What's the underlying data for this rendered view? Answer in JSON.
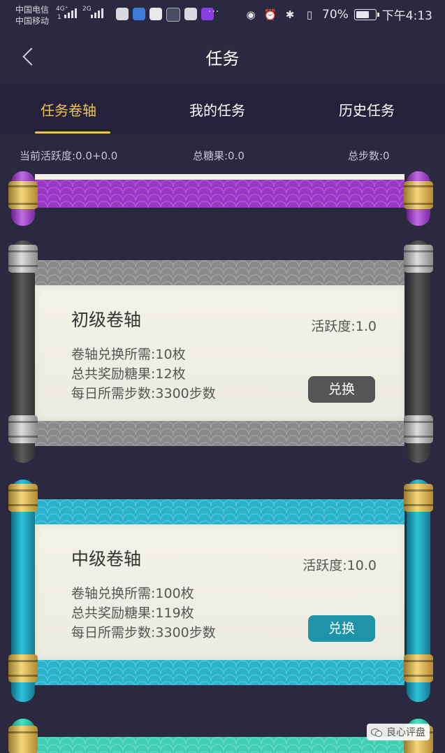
{
  "status_bar": {
    "carrier1": "中国电信",
    "carrier2": "中国移动",
    "net1": "4G⁺",
    "net1_sub": "1",
    "net2": "2G",
    "more": "···",
    "battery": "70%",
    "time": "下午4:13",
    "icons": [
      "eye-icon",
      "alarm-icon",
      "bluetooth-icon",
      "vibrate-icon",
      "battery-icon"
    ]
  },
  "header": {
    "title": "任务"
  },
  "tabs": [
    {
      "label": "任务卷轴",
      "active": true
    },
    {
      "label": "我的任务",
      "active": false
    },
    {
      "label": "历史任务",
      "active": false
    }
  ],
  "stats": {
    "activity": "当前活跃度:0.0+0.0",
    "candy": "总糖果:0.0",
    "steps": "总步数:0"
  },
  "scrolls": [
    {
      "title": "初级卷轴",
      "activity": "活跃度:1.0",
      "cost": "卷轴兑换所需:10枚",
      "reward": "总共奖励糖果:12枚",
      "steps": "每日所需步数:3300步数",
      "button": "兑换",
      "color": "#555555"
    },
    {
      "title": "中级卷轴",
      "activity": "活跃度:10.0",
      "cost": "卷轴兑换所需:100枚",
      "reward": "总共奖励糖果:119枚",
      "steps": "每日所需步数:3300步数",
      "button": "兑换",
      "color": "#1f93a8"
    }
  ],
  "watermark": "良心评盘",
  "colors": {
    "background": "#2b2940",
    "tab_active": "#f2c24e",
    "purple": "#9b37c7",
    "teal": "#2ab3cc"
  }
}
